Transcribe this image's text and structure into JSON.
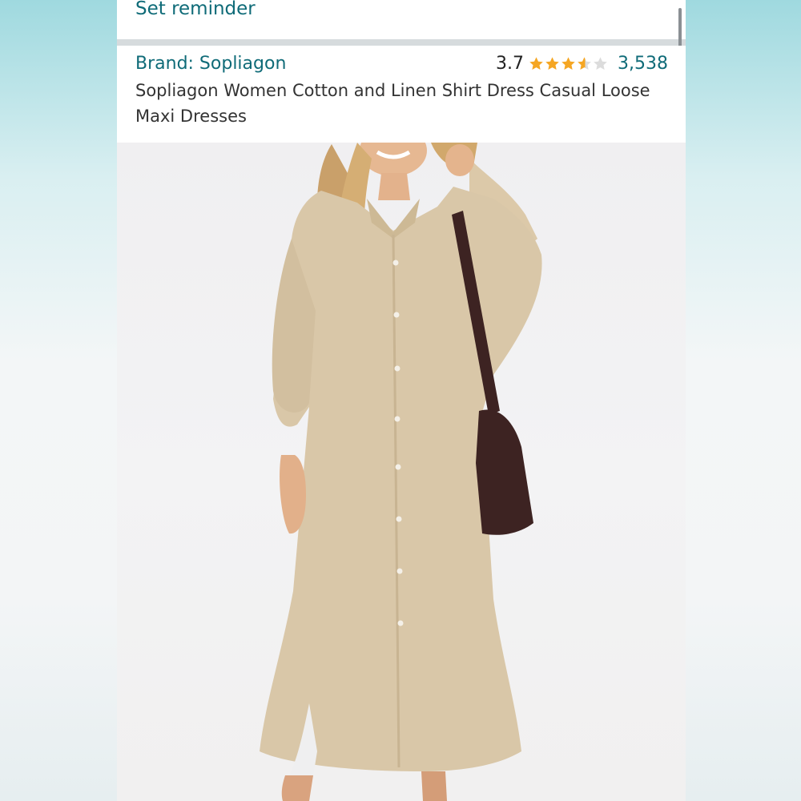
{
  "reminder": {
    "label": "Set reminder"
  },
  "product": {
    "brand_label": "Brand: Sopliagon",
    "rating": "3.7",
    "stars": {
      "filled": 3,
      "half": 1,
      "empty": 1,
      "value": 3.7,
      "color": "#f5a623"
    },
    "review_count": "3,538",
    "title": "Sopliagon Women Cotton and Linen Shirt Dress Casual Loose Maxi Dresses"
  },
  "colors": {
    "link": "#0f6b78",
    "dress": "#d9c7a8",
    "bag": "#3d2322"
  },
  "icons": {
    "star_full": "star-icon",
    "star_half": "star-half-icon",
    "star_empty": "star-empty-icon"
  }
}
